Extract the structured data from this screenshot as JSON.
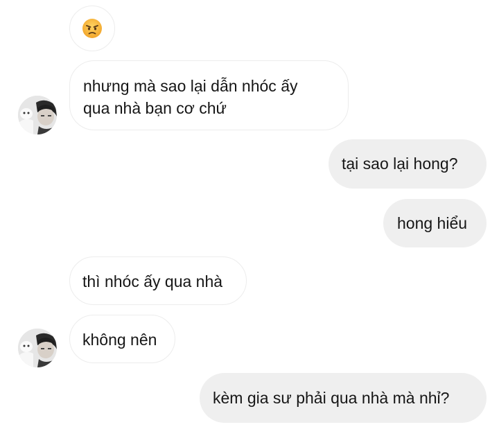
{
  "messages": [
    {
      "id": "m0",
      "direction": "incoming",
      "emoji": "angry-face"
    },
    {
      "id": "m1",
      "direction": "incoming",
      "lines": [
        "nhưng mà sao lại dẫn nhóc ấy",
        "qua nhà bạn cơ chứ"
      ]
    },
    {
      "id": "m2",
      "direction": "outgoing",
      "text": "tại sao lại hong?"
    },
    {
      "id": "m3",
      "direction": "outgoing",
      "text": "hong hiểu"
    },
    {
      "id": "m4",
      "direction": "incoming",
      "text": "thì nhóc ấy qua nhà"
    },
    {
      "id": "m5",
      "direction": "incoming",
      "text": "không nên"
    },
    {
      "id": "m6",
      "direction": "outgoing",
      "text": "kèm gia sư phải qua nhà mà nhỉ?"
    }
  ],
  "colors": {
    "incoming_bubble": "#ffffff",
    "incoming_border": "#ececec",
    "outgoing_bubble": "#efefef",
    "text": "#161616",
    "emoji_face": "#f6b53e"
  }
}
